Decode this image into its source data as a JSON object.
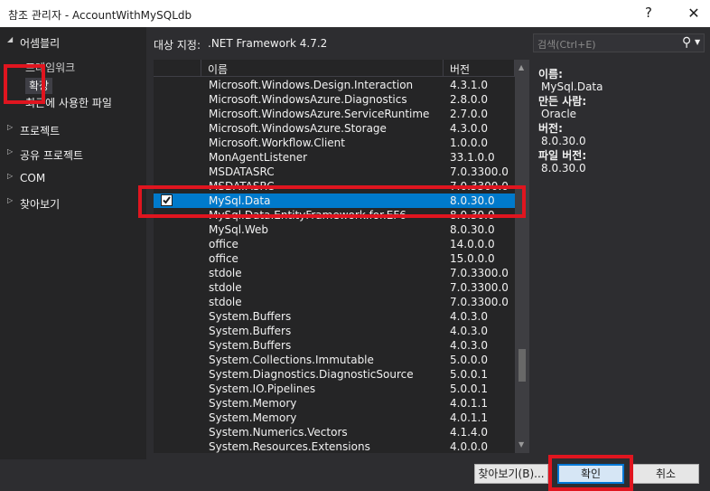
{
  "window": {
    "title": "참조 관리자 - AccountWithMySQLdb",
    "help": "?",
    "close": "✕"
  },
  "sidebar": {
    "assemblies": "어셈블리",
    "framework": "프레임워크",
    "extensions": "확장",
    "recent": "최근에 사용한 파일",
    "projects": "프로젝트",
    "shared_projects": "공유 프로젝트",
    "com": "COM",
    "browse": "찾아보기"
  },
  "target": {
    "label": "대상 지정:",
    "value": ".NET Framework 4.7.2"
  },
  "search": {
    "placeholder": "검색(Ctrl+E)"
  },
  "grid": {
    "col_name": "이름",
    "col_version": "버전",
    "rows": [
      {
        "name": "Microsoft.Windows.Design.Interaction",
        "version": "4.3.1.0"
      },
      {
        "name": "Microsoft.WindowsAzure.Diagnostics",
        "version": "2.8.0.0"
      },
      {
        "name": "Microsoft.WindowsAzure.ServiceRuntime",
        "version": "2.7.0.0"
      },
      {
        "name": "Microsoft.WindowsAzure.Storage",
        "version": "4.3.0.0"
      },
      {
        "name": "Microsoft.Workflow.Client",
        "version": "1.0.0.0"
      },
      {
        "name": "MonAgentListener",
        "version": "33.1.0.0"
      },
      {
        "name": "MSDATASRC",
        "version": "7.0.3300.0"
      },
      {
        "name": "MSDATASRC",
        "version": "7.0.3300.0"
      },
      {
        "name": "MySql.Data",
        "version": "8.0.30.0",
        "selected": true,
        "checked": true
      },
      {
        "name": "MySql.Data.EntityFramework.for.EF6",
        "version": "8.0.30.0"
      },
      {
        "name": "MySql.Web",
        "version": "8.0.30.0"
      },
      {
        "name": "office",
        "version": "14.0.0.0"
      },
      {
        "name": "office",
        "version": "15.0.0.0"
      },
      {
        "name": "stdole",
        "version": "7.0.3300.0"
      },
      {
        "name": "stdole",
        "version": "7.0.3300.0"
      },
      {
        "name": "stdole",
        "version": "7.0.3300.0"
      },
      {
        "name": "System.Buffers",
        "version": "4.0.3.0"
      },
      {
        "name": "System.Buffers",
        "version": "4.0.3.0"
      },
      {
        "name": "System.Buffers",
        "version": "4.0.3.0"
      },
      {
        "name": "System.Collections.Immutable",
        "version": "5.0.0.0"
      },
      {
        "name": "System.Diagnostics.DiagnosticSource",
        "version": "5.0.0.1"
      },
      {
        "name": "System.IO.Pipelines",
        "version": "5.0.0.1"
      },
      {
        "name": "System.Memory",
        "version": "4.0.1.1"
      },
      {
        "name": "System.Memory",
        "version": "4.0.1.1"
      },
      {
        "name": "System.Numerics.Vectors",
        "version": "4.1.4.0"
      },
      {
        "name": "System.Resources.Extensions",
        "version": "4.0.0.0"
      }
    ]
  },
  "details": {
    "name_label": "이름:",
    "name_value": "MySql.Data",
    "author_label": "만든 사람:",
    "author_value": "Oracle",
    "version_label": "버전:",
    "version_value": "8.0.30.0",
    "file_version_label": "파일 버전:",
    "file_version_value": "8.0.30.0"
  },
  "buttons": {
    "browse": "찾아보기(B)...",
    "ok": "확인",
    "cancel": "취소"
  },
  "colors": {
    "highlight": "#e0151f",
    "selection": "#007acc"
  }
}
